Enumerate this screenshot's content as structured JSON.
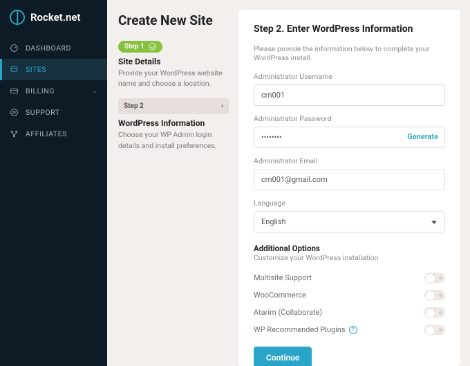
{
  "brand": {
    "name": "Rocket.net"
  },
  "nav": {
    "dashboard": "DASHBOARD",
    "sites": "SITES",
    "billing": "BILLING",
    "support": "SUPPORT",
    "affiliates": "AFFILIATES"
  },
  "page": {
    "title": "Create New Site",
    "step1_chip": "Step 1",
    "step1_head": "Site Details",
    "step1_desc": "Provide your WordPress website name and choose a location.",
    "step2_chip": "Step 2",
    "step2_head": "WordPress Information",
    "step2_desc": "Choose your WP Admin login details and install preferences."
  },
  "form": {
    "heading": "Step 2. Enter WordPress Information",
    "intro": "Please provide the information below to complete your WordPress install.",
    "username_label": "Administrator Username",
    "username_value": "crn001",
    "password_label": "Administrator Password",
    "password_value": "••••••••",
    "generate": "Generate",
    "email_label": "Administrator Email",
    "email_value": "crn001@gmail.com",
    "language_label": "Language",
    "language_value": "English",
    "additional_head": "Additional Options",
    "additional_sub": "Customize your WordPress installation",
    "opts": {
      "multisite": "Multisite Support",
      "woocommerce": "WooCommerce",
      "atarim": "Atarim (Collaborate)",
      "wp_plugins": "WP Recommended Plugins"
    },
    "continue": "Continue"
  }
}
